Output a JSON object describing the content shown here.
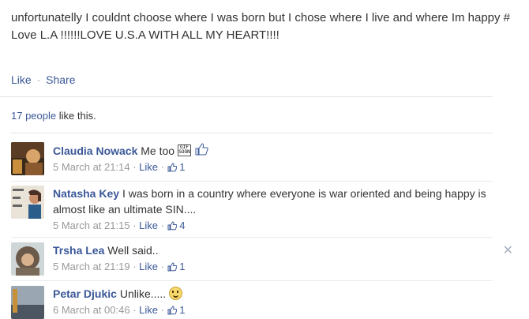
{
  "post": {
    "text": "unfortunatelly I couldnt choose where I was born but I chose where I live and where Im happy # Love L.A !!!!!!LOVE U.S.A WITH ALL MY HEART!!!!"
  },
  "actions": {
    "like": "Like",
    "separator": "·",
    "share": "Share"
  },
  "likes": {
    "people": "17 people",
    "suffix": " like this."
  },
  "comments": [
    {
      "author": "Claudia Nowack",
      "text": "Me too",
      "time": "5 March at 21:14",
      "like": "Like",
      "count": "1",
      "badge": "GIF\nSOON"
    },
    {
      "author": "Natasha Key",
      "text": "I was born in a country where everyone is war oriented and being happy is almost like an ultimate SIN....",
      "time": "5 March at 21:15",
      "like": "Like",
      "count": "4"
    },
    {
      "author": "Trsha Lea",
      "text": "Well said..",
      "time": "5 March at 21:19",
      "like": "Like",
      "count": "1"
    },
    {
      "author": "Petar Djukic",
      "text": "Unlike.....",
      "time": "6 March at 00:46",
      "like": "Like",
      "count": "1"
    }
  ],
  "colors": {
    "link": "#3b5998",
    "meta": "#999999",
    "text": "#333333"
  }
}
